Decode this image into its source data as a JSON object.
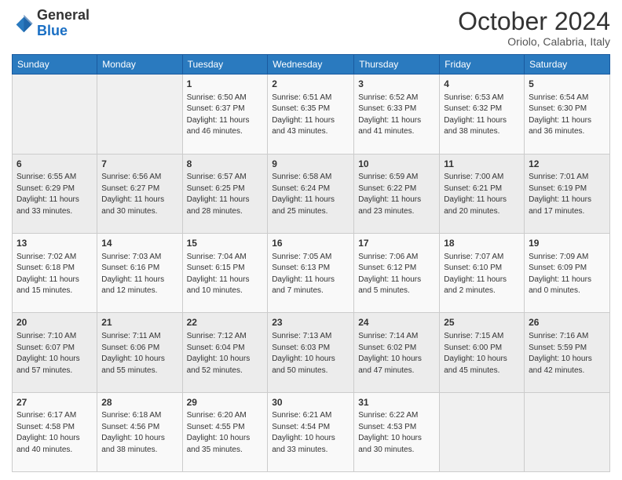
{
  "header": {
    "logo_general": "General",
    "logo_blue": "Blue",
    "month_title": "October 2024",
    "location": "Oriolo, Calabria, Italy"
  },
  "days_of_week": [
    "Sunday",
    "Monday",
    "Tuesday",
    "Wednesday",
    "Thursday",
    "Friday",
    "Saturday"
  ],
  "weeks": [
    [
      {
        "day": "",
        "info": ""
      },
      {
        "day": "",
        "info": ""
      },
      {
        "day": "1",
        "info": "Sunrise: 6:50 AM\nSunset: 6:37 PM\nDaylight: 11 hours and 46 minutes."
      },
      {
        "day": "2",
        "info": "Sunrise: 6:51 AM\nSunset: 6:35 PM\nDaylight: 11 hours and 43 minutes."
      },
      {
        "day": "3",
        "info": "Sunrise: 6:52 AM\nSunset: 6:33 PM\nDaylight: 11 hours and 41 minutes."
      },
      {
        "day": "4",
        "info": "Sunrise: 6:53 AM\nSunset: 6:32 PM\nDaylight: 11 hours and 38 minutes."
      },
      {
        "day": "5",
        "info": "Sunrise: 6:54 AM\nSunset: 6:30 PM\nDaylight: 11 hours and 36 minutes."
      }
    ],
    [
      {
        "day": "6",
        "info": "Sunrise: 6:55 AM\nSunset: 6:29 PM\nDaylight: 11 hours and 33 minutes."
      },
      {
        "day": "7",
        "info": "Sunrise: 6:56 AM\nSunset: 6:27 PM\nDaylight: 11 hours and 30 minutes."
      },
      {
        "day": "8",
        "info": "Sunrise: 6:57 AM\nSunset: 6:25 PM\nDaylight: 11 hours and 28 minutes."
      },
      {
        "day": "9",
        "info": "Sunrise: 6:58 AM\nSunset: 6:24 PM\nDaylight: 11 hours and 25 minutes."
      },
      {
        "day": "10",
        "info": "Sunrise: 6:59 AM\nSunset: 6:22 PM\nDaylight: 11 hours and 23 minutes."
      },
      {
        "day": "11",
        "info": "Sunrise: 7:00 AM\nSunset: 6:21 PM\nDaylight: 11 hours and 20 minutes."
      },
      {
        "day": "12",
        "info": "Sunrise: 7:01 AM\nSunset: 6:19 PM\nDaylight: 11 hours and 17 minutes."
      }
    ],
    [
      {
        "day": "13",
        "info": "Sunrise: 7:02 AM\nSunset: 6:18 PM\nDaylight: 11 hours and 15 minutes."
      },
      {
        "day": "14",
        "info": "Sunrise: 7:03 AM\nSunset: 6:16 PM\nDaylight: 11 hours and 12 minutes."
      },
      {
        "day": "15",
        "info": "Sunrise: 7:04 AM\nSunset: 6:15 PM\nDaylight: 11 hours and 10 minutes."
      },
      {
        "day": "16",
        "info": "Sunrise: 7:05 AM\nSunset: 6:13 PM\nDaylight: 11 hours and 7 minutes."
      },
      {
        "day": "17",
        "info": "Sunrise: 7:06 AM\nSunset: 6:12 PM\nDaylight: 11 hours and 5 minutes."
      },
      {
        "day": "18",
        "info": "Sunrise: 7:07 AM\nSunset: 6:10 PM\nDaylight: 11 hours and 2 minutes."
      },
      {
        "day": "19",
        "info": "Sunrise: 7:09 AM\nSunset: 6:09 PM\nDaylight: 11 hours and 0 minutes."
      }
    ],
    [
      {
        "day": "20",
        "info": "Sunrise: 7:10 AM\nSunset: 6:07 PM\nDaylight: 10 hours and 57 minutes."
      },
      {
        "day": "21",
        "info": "Sunrise: 7:11 AM\nSunset: 6:06 PM\nDaylight: 10 hours and 55 minutes."
      },
      {
        "day": "22",
        "info": "Sunrise: 7:12 AM\nSunset: 6:04 PM\nDaylight: 10 hours and 52 minutes."
      },
      {
        "day": "23",
        "info": "Sunrise: 7:13 AM\nSunset: 6:03 PM\nDaylight: 10 hours and 50 minutes."
      },
      {
        "day": "24",
        "info": "Sunrise: 7:14 AM\nSunset: 6:02 PM\nDaylight: 10 hours and 47 minutes."
      },
      {
        "day": "25",
        "info": "Sunrise: 7:15 AM\nSunset: 6:00 PM\nDaylight: 10 hours and 45 minutes."
      },
      {
        "day": "26",
        "info": "Sunrise: 7:16 AM\nSunset: 5:59 PM\nDaylight: 10 hours and 42 minutes."
      }
    ],
    [
      {
        "day": "27",
        "info": "Sunrise: 6:17 AM\nSunset: 4:58 PM\nDaylight: 10 hours and 40 minutes."
      },
      {
        "day": "28",
        "info": "Sunrise: 6:18 AM\nSunset: 4:56 PM\nDaylight: 10 hours and 38 minutes."
      },
      {
        "day": "29",
        "info": "Sunrise: 6:20 AM\nSunset: 4:55 PM\nDaylight: 10 hours and 35 minutes."
      },
      {
        "day": "30",
        "info": "Sunrise: 6:21 AM\nSunset: 4:54 PM\nDaylight: 10 hours and 33 minutes."
      },
      {
        "day": "31",
        "info": "Sunrise: 6:22 AM\nSunset: 4:53 PM\nDaylight: 10 hours and 30 minutes."
      },
      {
        "day": "",
        "info": ""
      },
      {
        "day": "",
        "info": ""
      }
    ]
  ]
}
